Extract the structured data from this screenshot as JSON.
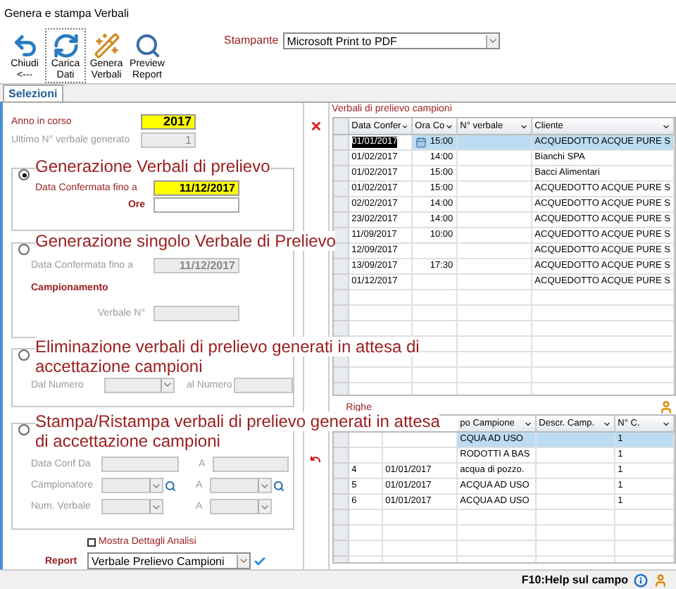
{
  "window": {
    "title": "Genera e stampa Verbali"
  },
  "toolbar": [
    {
      "kind": "back",
      "lines": [
        "Chiudi",
        "<---"
      ],
      "focused": false
    },
    {
      "kind": "reload",
      "lines": [
        "Carica",
        "Dati"
      ],
      "focused": true
    },
    {
      "kind": "wand",
      "lines": [
        "Genera",
        "Verbali"
      ],
      "focused": false
    },
    {
      "kind": "preview",
      "lines": [
        "Preview",
        "Report"
      ],
      "focused": false
    }
  ],
  "printer": {
    "label": "Stampante",
    "value": "Microsoft Print to PDF"
  },
  "tabs": [
    {
      "label": "Selezioni",
      "selected": true
    }
  ],
  "anno": {
    "label": "Anno in corso",
    "value": "2017"
  },
  "ultimo": {
    "label": "Ultimo N° verbale generato",
    "value": "1"
  },
  "groups": [
    {
      "title": "Generazione Verbali di prelievo",
      "selected": true,
      "date_label": "Data Confermata fino a",
      "date": "11/12/2017",
      "ore_label": "Ore"
    },
    {
      "title": "Generazione singolo Verbale di Prelievo",
      "selected": false,
      "date_label": "Data Confermata fino a",
      "date": "11/12/2017",
      "section": "Campionamento",
      "verbale_label": "Verbale N°"
    },
    {
      "title": "Eliminazione verbali di prelievo generati in attesa di accettazione campioni",
      "selected": false,
      "from_label": "Dal Numero",
      "to_label": "al Numero"
    },
    {
      "title": "Stampa/Ristampa verbali di prelievo generati in attesa di accettazione campioni",
      "selected": false,
      "rows": [
        {
          "label": "Data Conf Da",
          "kind": "input",
          "to": "A"
        },
        {
          "label": "Campionatore",
          "kind": "lookup",
          "to": "A"
        },
        {
          "label": "Num. Verbale",
          "kind": "select",
          "to": "A"
        }
      ]
    }
  ],
  "details_checkbox": {
    "label": "Mostra Dettagli Analisi",
    "checked": false
  },
  "report": {
    "label": "Report",
    "value": "Verbale Prelievo Campioni"
  },
  "upper_grid": {
    "title": "Verbali di prelievo campioni",
    "columns": [
      "Data Confer",
      "Ora Co",
      "N° verbale",
      "Cliente"
    ],
    "rows": [
      {
        "date": "01/01/2017",
        "time": "15:00",
        "client": "ACQUEDOTTO ACQUE PURE S",
        "selected": true
      },
      {
        "date": "01/02/2017",
        "time": "14:00",
        "client": "Bianchi SPA",
        "selected": false
      },
      {
        "date": "01/02/2017",
        "time": "15:00",
        "client": "Bacci Alimentari",
        "selected": false
      },
      {
        "date": "01/02/2017",
        "time": "15:00",
        "client": "ACQUEDOTTO ACQUE PURE S",
        "selected": false
      },
      {
        "date": "02/02/2017",
        "time": "14:00",
        "client": "ACQUEDOTTO ACQUE PURE S",
        "selected": false
      },
      {
        "date": "23/02/2017",
        "time": "14:00",
        "client": "ACQUEDOTTO ACQUE PURE S",
        "selected": false
      },
      {
        "date": "11/09/2017",
        "time": "10:00",
        "client": "ACQUEDOTTO ACQUE PURE S",
        "selected": false
      },
      {
        "date": "12/09/2017",
        "client": "ACQUEDOTTO ACQUE PURE S",
        "selected": false
      },
      {
        "date": "13/09/2017",
        "time": "17:30",
        "client": "ACQUEDOTTO ACQUE PURE S",
        "selected": false
      },
      {
        "date": "01/12/2017",
        "client": "ACQUEDOTTO ACQUE PURE S",
        "selected": false
      }
    ]
  },
  "lower_grid": {
    "title": "Righe",
    "columns": [
      "po Campione",
      "Descr. Camp.",
      "N° C."
    ],
    "rows": [
      {
        "tipo": "CQUA AD USO",
        "nc": "1",
        "selected": true
      },
      {
        "tipo": "RODOTTI A BAS",
        "nc": "1",
        "selected": false
      },
      {
        "num": "4",
        "date": "01/01/2017",
        "tipo": "acqua di pozzo.",
        "nc": "1",
        "selected": false
      },
      {
        "num": "5",
        "date": "01/01/2017",
        "tipo": "ACQUA AD USO",
        "nc": "1",
        "selected": false
      },
      {
        "num": "6",
        "date": "01/01/2017",
        "tipo": "ACQUA AD USO",
        "nc": "1",
        "selected": false
      }
    ]
  },
  "status": {
    "help": "F10:Help sul campo"
  }
}
